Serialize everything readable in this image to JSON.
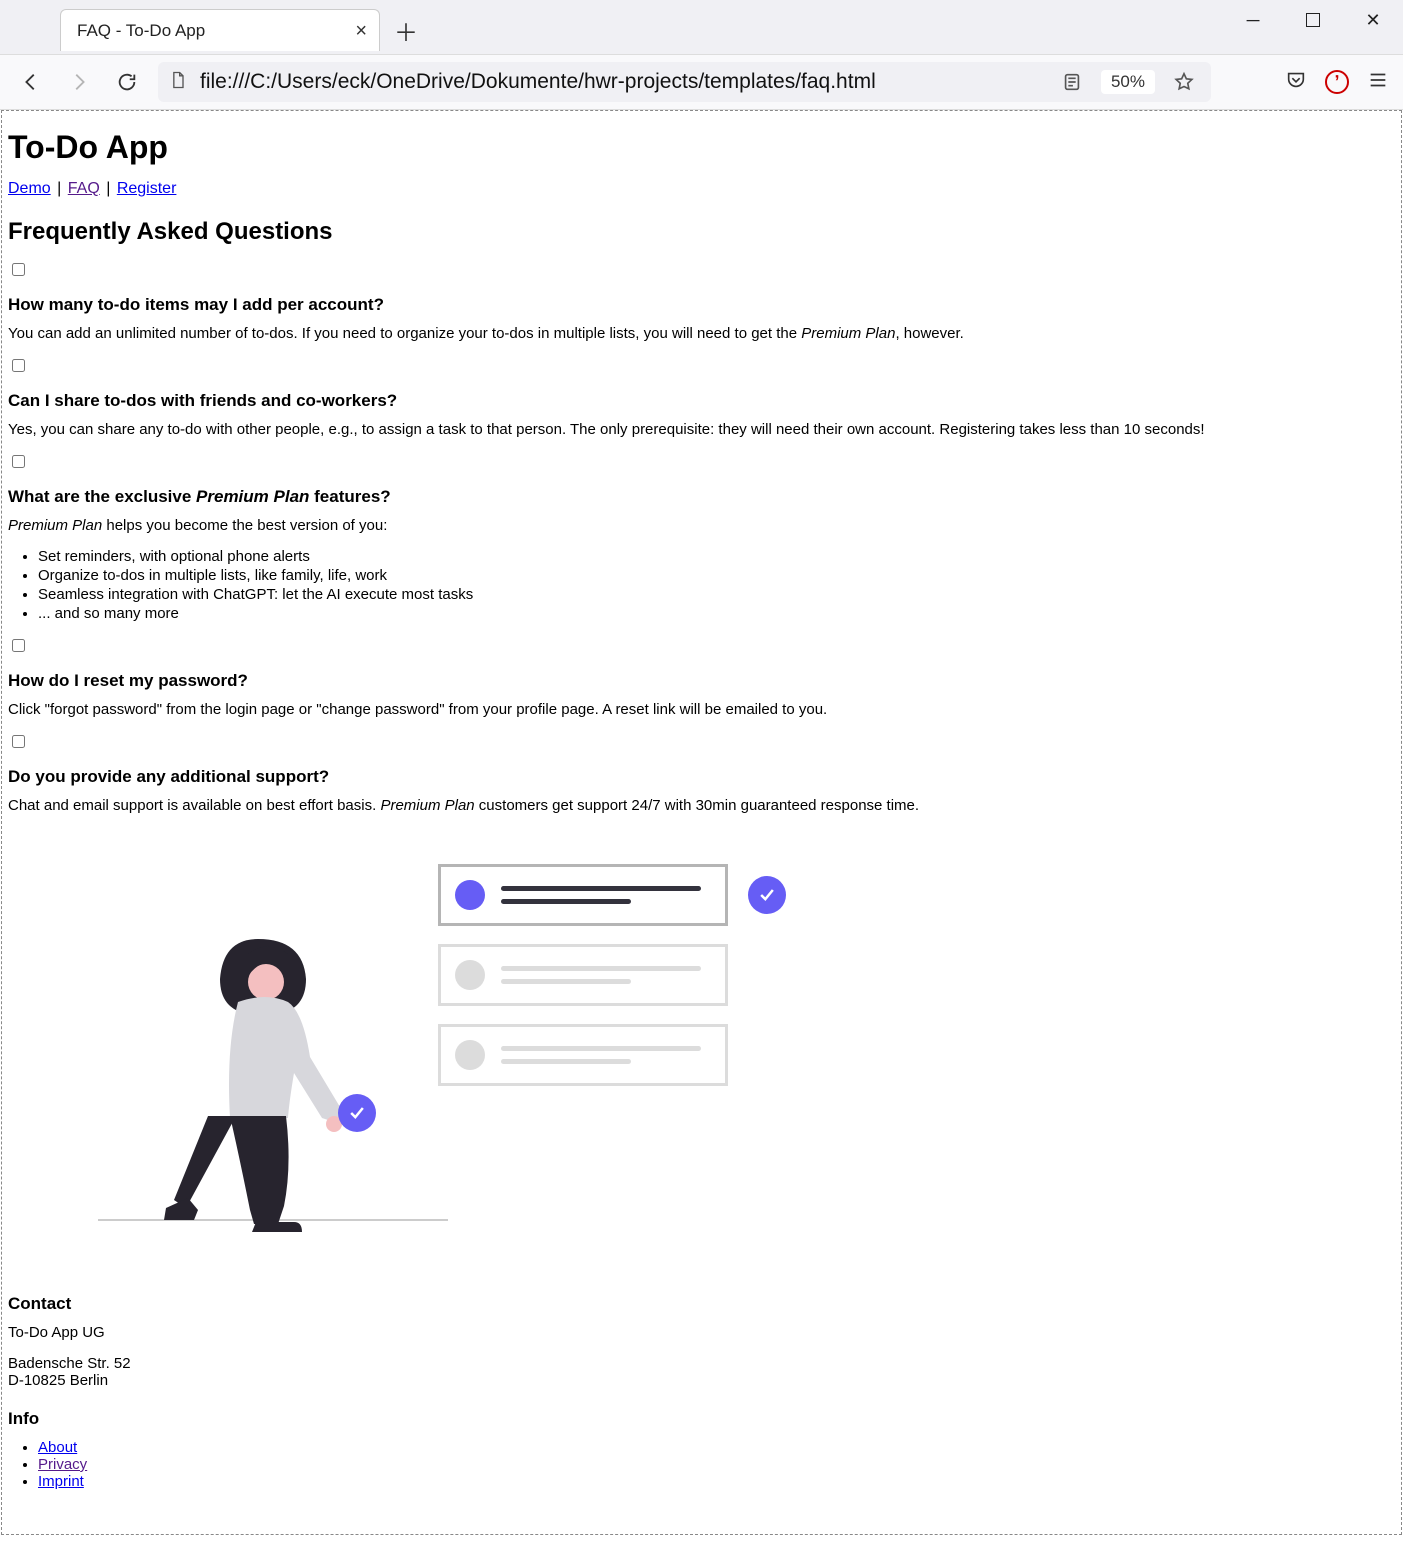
{
  "browser": {
    "tab_title": "FAQ - To-Do App",
    "url": "file:///C:/Users/eck/OneDrive/Dokumente/hwr-projects/templates/faq.html",
    "zoom": "50%"
  },
  "header": {
    "app_title": "To-Do App",
    "nav": {
      "demo": "Demo",
      "faq": "FAQ",
      "register": "Register"
    }
  },
  "faq": {
    "heading": "Frequently Asked Questions",
    "items": [
      {
        "q": "How many to-do items may I add per account?",
        "a_before": "You can add an unlimited number of to-dos. If you need to organize your to-dos in multiple lists, you will need to get the ",
        "a_em": "Premium Plan",
        "a_after": ", however."
      },
      {
        "q": "Can I share to-dos with friends and co-workers?",
        "a": "Yes, you can share any to-do with other people, e.g., to assign a task to that person. The only prerequisite: they will need their own account. Registering takes less than 10 seconds!"
      },
      {
        "q_before": "What are the exclusive ",
        "q_em": "Premium Plan",
        "q_after": " features?",
        "intro_em": "Premium Plan",
        "intro_after": " helps you become the best version of you:",
        "bullets": [
          "Set reminders, with optional phone alerts",
          "Organize to-dos in multiple lists, like family, life, work",
          "Seamless integration with ChatGPT: let the AI execute most tasks",
          "... and so many more"
        ]
      },
      {
        "q": "How do I reset my password?",
        "a": "Click \"forgot password\" from the login page or \"change password\" from your profile page. A reset link will be emailed to you."
      },
      {
        "q": "Do you provide any additional support?",
        "a_before": "Chat and email support is available on best effort basis. ",
        "a_em": "Premium Plan",
        "a_after": " customers get support 24/7 with 30min guaranteed response time."
      }
    ]
  },
  "footer": {
    "contact_heading": "Contact",
    "company": "To-Do App UG",
    "street": "Badensche Str. 52",
    "city": "D-10825 Berlin",
    "info_heading": "Info",
    "links": {
      "about": "About",
      "privacy": "Privacy",
      "imprint": "Imprint"
    }
  }
}
